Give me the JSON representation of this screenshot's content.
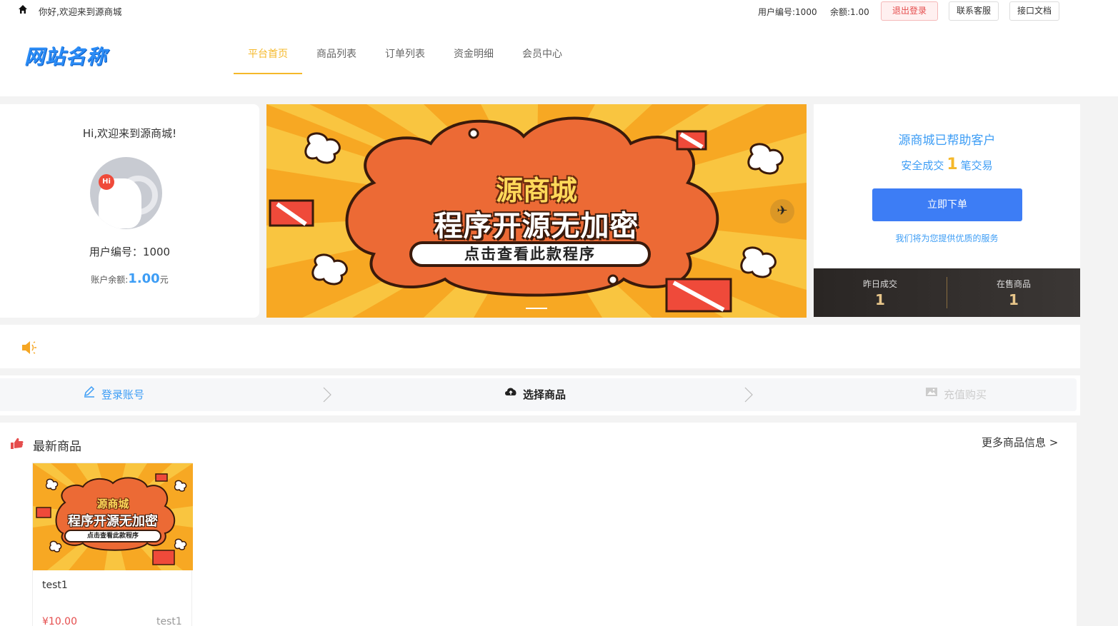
{
  "topbar": {
    "greeting": "你好,欢迎来到源商城",
    "user_id": "用户编号:1000",
    "balance": "余额:1.00",
    "logout": "退出登录",
    "service": "联系客服",
    "api_docs": "接口文档"
  },
  "header": {
    "logo": "网站名称",
    "nav": [
      {
        "label": "平台首页",
        "active": true
      },
      {
        "label": "商品列表"
      },
      {
        "label": "订单列表"
      },
      {
        "label": "资金明细"
      },
      {
        "label": "会员中心"
      }
    ]
  },
  "user_panel": {
    "welcome": "Hi,欢迎来到源商城!",
    "avatar_badge": "Hi",
    "user_id": "用户编号：1000",
    "balance_label": "账户余额:",
    "balance_value": "1.00",
    "balance_unit": "元"
  },
  "banner": {
    "line1": "源商城",
    "line2": "程序开源无加密",
    "button": "点击查看此款程序"
  },
  "stats": {
    "line1": "源商城已帮助客户",
    "line2_prefix": "安全成交",
    "line2_count": "1",
    "line2_suffix": "笔交易",
    "order_button": "立即下单",
    "note": "我们将为您提供优质的服务",
    "yesterday_label": "昨日成交",
    "yesterday_value": "1",
    "on_sale_label": "在售商品",
    "on_sale_value": "1"
  },
  "steps": [
    {
      "label": "登录账号",
      "icon": "edit-icon"
    },
    {
      "label": "选择商品",
      "icon": "cloud-upload-icon"
    },
    {
      "label": "充值购买",
      "icon": "image-icon"
    }
  ],
  "products": {
    "title": "最新商品",
    "more": "更多商品信息 >",
    "items": [
      {
        "name": "test1",
        "price": "¥10.00",
        "stock": "test1",
        "image_line1": "源商城",
        "image_line2": "程序开源无加密",
        "image_button": "点击查看此款程序"
      }
    ]
  },
  "colors": {
    "accent_yellow": "#f5b82a",
    "accent_blue": "#3d9df5",
    "button_blue": "#3d7df5",
    "danger": "#e54d4d"
  }
}
